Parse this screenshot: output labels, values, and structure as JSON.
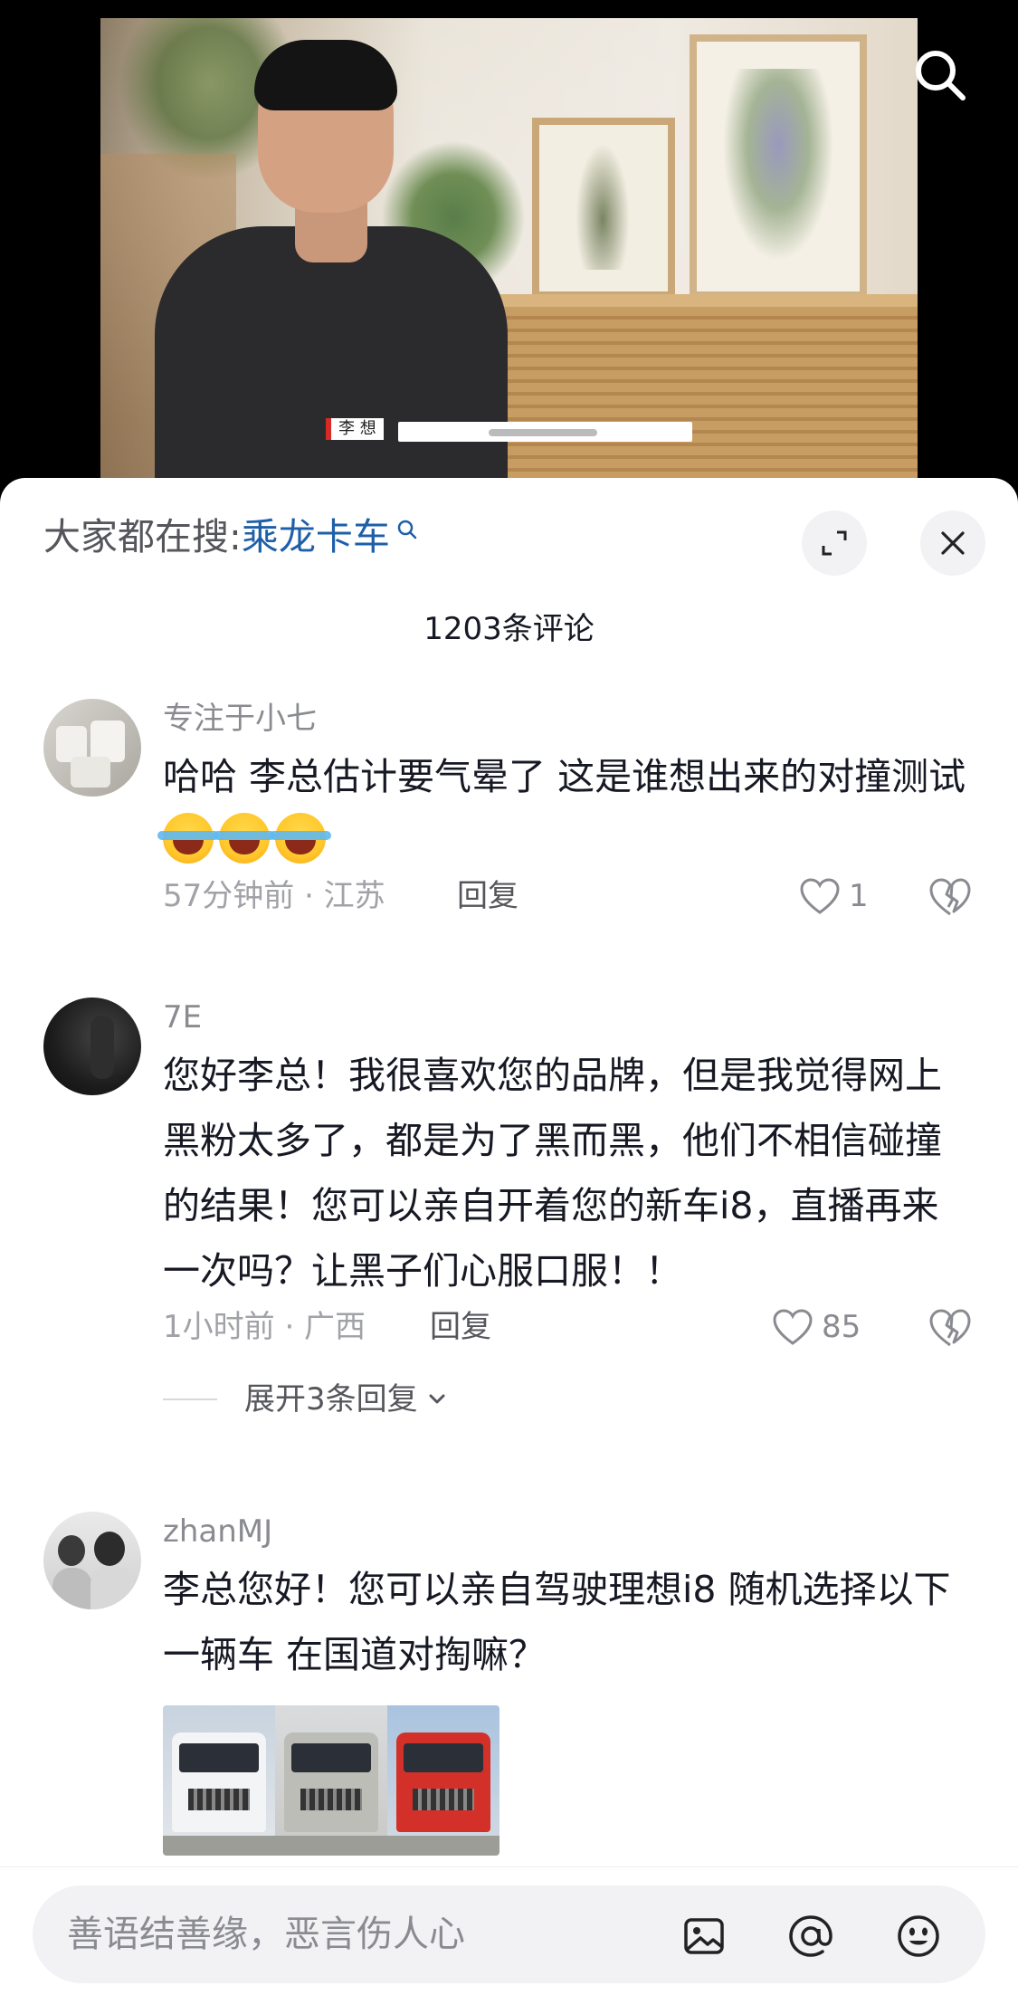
{
  "video": {
    "caption_name": "李 想",
    "search_icon": "search-icon"
  },
  "sheet": {
    "hot_search_prefix": "大家都在搜:",
    "hot_search_term": "乘龙卡车",
    "comment_count": "1203条评论",
    "expand_icon": "expand-icon",
    "close_icon": "close-icon"
  },
  "comments": [
    {
      "username": "专注于小七",
      "content": "哈哈 李总估计要气晕了 这是谁想出来的对撞测试",
      "emoji_count": 3,
      "meta": "57分钟前 · 江苏",
      "reply_label": "回复",
      "likes": "1"
    },
    {
      "username": "7E",
      "content": "您好李总！我很喜欢您的品牌，但是我觉得网上黑粉太多了，都是为了黑而黑，他们不相信碰撞的结果！您可以亲自开着您的新车i8，直播再来一次吗？让黑子们心服口服！！",
      "meta": "1小时前 · 广西",
      "reply_label": "回复",
      "likes": "85",
      "expand_label": "展开3条回复"
    },
    {
      "username": "zhanMJ",
      "content": "李总您好！您可以亲自驾驶理想i8 随机选择以下一辆车 在国道对掏嘛？",
      "images": [
        "white-truck",
        "silver-truck",
        "red-truck"
      ]
    }
  ],
  "input": {
    "placeholder": "善语结善缘，恶言伤人心",
    "icons": [
      "image-icon",
      "at-icon",
      "emoji-icon"
    ]
  },
  "colors": {
    "accent_link": "#1e5fa8",
    "text_primary": "#161823",
    "text_secondary": "#8a8b91"
  }
}
